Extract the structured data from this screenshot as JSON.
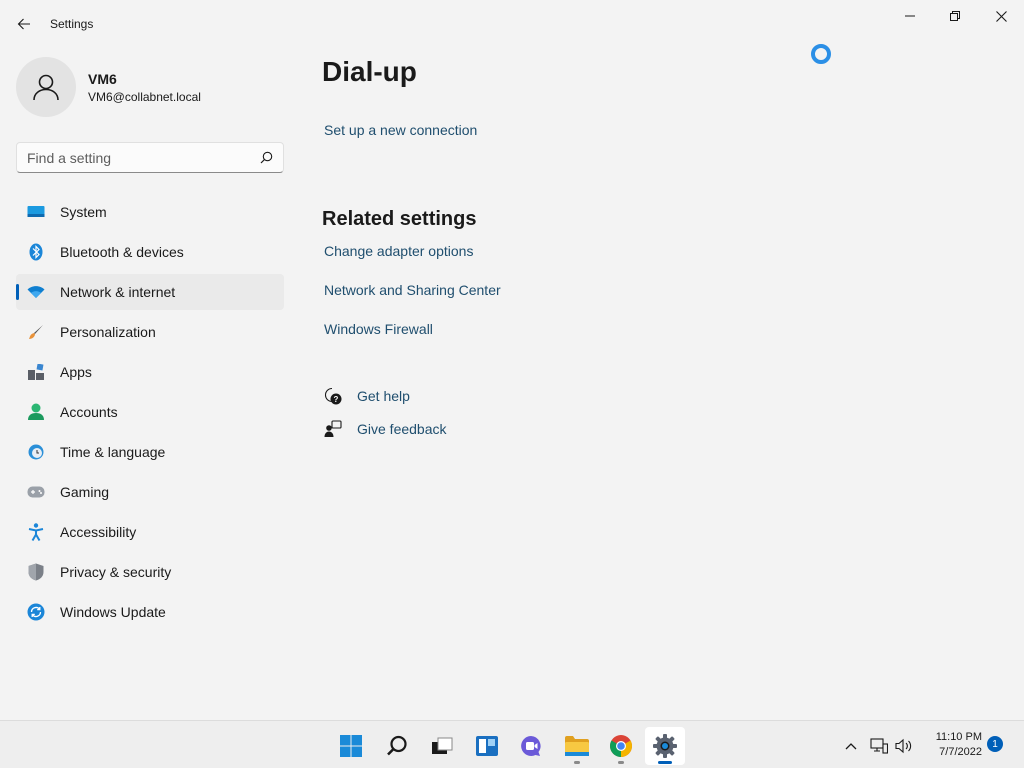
{
  "window": {
    "app_title": "Settings",
    "back_icon": "arrow-left-icon",
    "controls": [
      "minimize-icon",
      "maximize-icon",
      "close-icon"
    ]
  },
  "profile": {
    "name": "VM6",
    "email": "VM6@collabnet.local",
    "avatar_icon": "person-icon"
  },
  "search": {
    "placeholder": "Find a setting",
    "icon": "search-icon"
  },
  "sidebar": {
    "items": [
      {
        "label": "System",
        "icon": "monitor-icon"
      },
      {
        "label": "Bluetooth & devices",
        "icon": "bluetooth-icon"
      },
      {
        "label": "Network & internet",
        "icon": "wifi-icon",
        "active": true
      },
      {
        "label": "Personalization",
        "icon": "brush-icon"
      },
      {
        "label": "Apps",
        "icon": "apps-icon"
      },
      {
        "label": "Accounts",
        "icon": "account-icon"
      },
      {
        "label": "Time & language",
        "icon": "clock-globe-icon"
      },
      {
        "label": "Gaming",
        "icon": "gamepad-icon"
      },
      {
        "label": "Accessibility",
        "icon": "accessibility-icon"
      },
      {
        "label": "Privacy & security",
        "icon": "shield-icon"
      },
      {
        "label": "Windows Update",
        "icon": "update-icon"
      }
    ]
  },
  "main": {
    "title": "Dial-up",
    "setup_link": "Set up a new connection",
    "related_heading": "Related settings",
    "related_links": [
      "Change adapter options",
      "Network and Sharing Center",
      "Windows Firewall"
    ],
    "help": [
      {
        "label": "Get help",
        "icon": "help-chat-icon"
      },
      {
        "label": "Give feedback",
        "icon": "feedback-icon"
      }
    ]
  },
  "taskbar": {
    "apps": [
      {
        "name": "start",
        "icon": "windows-logo-icon"
      },
      {
        "name": "search",
        "icon": "search-icon"
      },
      {
        "name": "task-view",
        "icon": "task-view-icon"
      },
      {
        "name": "widgets",
        "icon": "widgets-icon"
      },
      {
        "name": "teams-chat",
        "icon": "chat-icon"
      },
      {
        "name": "file-explorer",
        "icon": "folder-icon"
      },
      {
        "name": "chrome",
        "icon": "chrome-icon"
      },
      {
        "name": "settings",
        "icon": "gear-icon",
        "active": true
      }
    ],
    "tray": [
      "chevron-up-icon",
      "network-icon",
      "volume-icon"
    ],
    "time": "11:10 PM",
    "date": "7/7/2022",
    "notification_count": "1"
  },
  "colors": {
    "accent": "#005fb8",
    "link": "#1f4e6e",
    "background": "#f3f3f3"
  }
}
